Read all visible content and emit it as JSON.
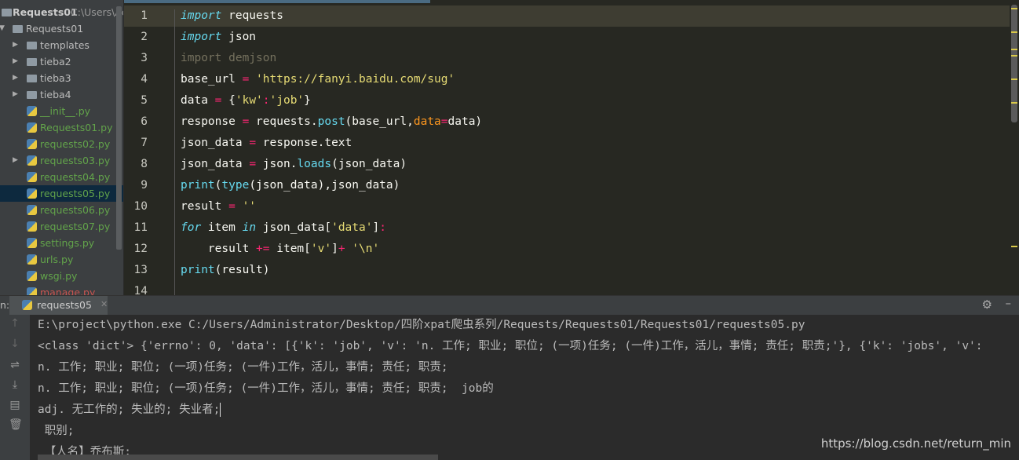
{
  "project_header": {
    "name": "Requests01",
    "path": "C:\\Users\\Ac"
  },
  "tree": [
    {
      "label": "Requests01",
      "type": "folder",
      "level": 0,
      "expanded": true
    },
    {
      "label": "templates",
      "type": "folder",
      "level": 1
    },
    {
      "label": "tieba2",
      "type": "folder",
      "level": 1
    },
    {
      "label": "tieba3",
      "type": "folder",
      "level": 1
    },
    {
      "label": "tieba4",
      "type": "folder",
      "level": 1
    },
    {
      "label": "__init__.py",
      "type": "py",
      "level": 1
    },
    {
      "label": "Requests01.py",
      "type": "py",
      "level": 1
    },
    {
      "label": "requests02.py",
      "type": "py",
      "level": 1
    },
    {
      "label": "requests03.py",
      "type": "py",
      "level": 1,
      "arrow": true
    },
    {
      "label": "requests04.py",
      "type": "py",
      "level": 1
    },
    {
      "label": "requests05.py",
      "type": "py",
      "level": 1,
      "selected": true
    },
    {
      "label": "requests06.py",
      "type": "py",
      "level": 1
    },
    {
      "label": "requests07.py",
      "type": "py",
      "level": 1
    },
    {
      "label": "settings.py",
      "type": "py",
      "level": 1
    },
    {
      "label": "urls.py",
      "type": "py",
      "level": 1
    },
    {
      "label": "wsgi.py",
      "type": "py",
      "level": 1
    },
    {
      "label": "manage.py",
      "type": "py-red",
      "level": 1
    }
  ],
  "code": [
    {
      "n": "1",
      "t": [
        [
          "import",
          "kw"
        ],
        [
          " requests",
          ""
        ]
      ]
    },
    {
      "n": "2",
      "t": [
        [
          "import",
          "kw"
        ],
        [
          " json",
          ""
        ]
      ]
    },
    {
      "n": "3",
      "t": [
        [
          "import demjson",
          "dim"
        ]
      ]
    },
    {
      "n": "4",
      "t": [
        [
          "base_url ",
          ""
        ],
        [
          "=",
          "op"
        ],
        [
          " ",
          ""
        ],
        [
          "'https://fanyi.baidu.com/sug'",
          "str"
        ]
      ]
    },
    {
      "n": "5",
      "t": [
        [
          "data ",
          ""
        ],
        [
          "=",
          "op"
        ],
        [
          " {",
          ""
        ],
        [
          "'kw'",
          "str"
        ],
        [
          ":",
          "op"
        ],
        [
          "'job'",
          "str"
        ],
        [
          "}",
          ""
        ]
      ]
    },
    {
      "n": "6",
      "t": [
        [
          "response ",
          ""
        ],
        [
          "=",
          "op"
        ],
        [
          " requests.",
          ""
        ],
        [
          "post",
          "fn"
        ],
        [
          "(base_url,",
          ""
        ],
        [
          "data",
          "par"
        ],
        [
          "=",
          "op"
        ],
        [
          "data)",
          ""
        ]
      ]
    },
    {
      "n": "7",
      "t": [
        [
          "json_data ",
          ""
        ],
        [
          "=",
          "op"
        ],
        [
          " response.text",
          ""
        ]
      ]
    },
    {
      "n": "8",
      "t": [
        [
          "json_data ",
          ""
        ],
        [
          "=",
          "op"
        ],
        [
          " json.",
          ""
        ],
        [
          "loads",
          "fn"
        ],
        [
          "(json_data)",
          ""
        ]
      ]
    },
    {
      "n": "9",
      "t": [
        [
          "print",
          "fn"
        ],
        [
          "(",
          ""
        ],
        [
          "type",
          "fn"
        ],
        [
          "(json_data),json_data)",
          ""
        ]
      ]
    },
    {
      "n": "10",
      "t": [
        [
          "result ",
          ""
        ],
        [
          "=",
          "op"
        ],
        [
          " ",
          ""
        ],
        [
          "''",
          "str"
        ]
      ]
    },
    {
      "n": "11",
      "t": [
        [
          "for",
          "kw"
        ],
        [
          " item ",
          ""
        ],
        [
          "in",
          "kw"
        ],
        [
          " json_data[",
          ""
        ],
        [
          "'data'",
          "str"
        ],
        [
          "]",
          ""
        ],
        [
          ":",
          "op"
        ]
      ]
    },
    {
      "n": "12",
      "t": [
        [
          "    result ",
          ""
        ],
        [
          "+=",
          "op"
        ],
        [
          " item[",
          ""
        ],
        [
          "'v'",
          "str"
        ],
        [
          "]",
          ""
        ],
        [
          "+",
          "op"
        ],
        [
          " ",
          ""
        ],
        [
          "'\\n'",
          "str"
        ]
      ]
    },
    {
      "n": "13",
      "t": [
        [
          "print",
          "fn"
        ],
        [
          "(result)",
          ""
        ]
      ]
    },
    {
      "n": "14",
      "t": []
    }
  ],
  "run": {
    "label": "n:",
    "tab": "requests05",
    "output": [
      "E:\\project\\python.exe C:/Users/Administrator/Desktop/四阶xpat爬虫系列/Requests/Requests01/Requests01/requests05.py",
      "<class 'dict'> {'errno': 0, 'data': [{'k': 'job', 'v': 'n. 工作; 职业; 职位; (一项)任务; (一件)工作，活儿，事情; 责任; 职责;'}, {'k': 'jobs', 'v':",
      "n. 工作; 职业; 职位; (一项)任务; (一件)工作，活儿，事情; 责任; 职责;",
      "n. 工作; 职业; 职位; (一项)任务; (一件)工作，活儿，事情; 责任; 职责;  job的",
      "adj. 无工作的; 失业的; 失业者;",
      " 职别;",
      " 【人名】乔布斯;"
    ]
  },
  "watermark": "https://blog.csdn.net/return_min",
  "colors": {
    "keyword": "#66d9ef",
    "string": "#e6db74",
    "operator": "#f92672",
    "editor_bg": "#272822",
    "sidebar_bg": "#3c3f41"
  }
}
